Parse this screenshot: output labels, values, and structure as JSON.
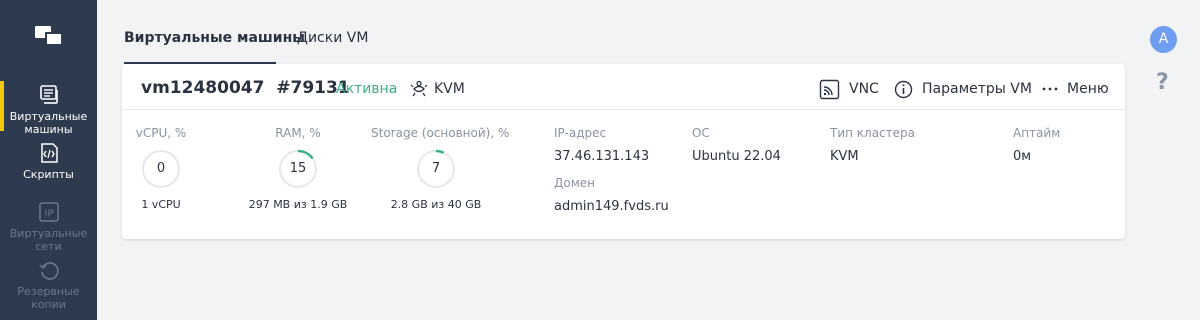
{
  "sidebar": {
    "items": [
      {
        "label": "Виртуальные машины",
        "icon": "server-icon",
        "state": "active"
      },
      {
        "label": "Скрипты",
        "icon": "script-icon",
        "state": "normal"
      },
      {
        "label": "Виртуальные сети",
        "icon": "ip-icon",
        "state": "disabled"
      },
      {
        "label": "Резервные копии",
        "icon": "backup-icon",
        "state": "disabled"
      }
    ]
  },
  "tabs": [
    {
      "label": "Виртуальные машины"
    },
    {
      "label": "Диски VM"
    }
  ],
  "vm": {
    "name": "vm12480047",
    "id": "#79131",
    "status": "Активна",
    "status_color": "#3dae89",
    "virtualization": "KVM",
    "actions": {
      "vnc": "VNC",
      "params": "Параметры VM",
      "menu": "Меню"
    },
    "metrics": {
      "cpu": {
        "label": "vCPU, %",
        "value": "0",
        "percent": 0,
        "sub": "1 vCPU"
      },
      "ram": {
        "label": "RAM, %",
        "value": "15",
        "percent": 15,
        "sub": "297 MB из 1.9 GB"
      },
      "storage": {
        "label": "Storage (основной), %",
        "value": "7",
        "percent": 7,
        "sub": "2.8 GB из 40 GB"
      }
    },
    "info": {
      "ip_label": "IP-адрес",
      "ip_value": "37.46.131.143",
      "domain_label": "Домен",
      "domain_value": "admin149.fvds.ru",
      "os_label": "ОС",
      "os_value": "Ubuntu 22.04",
      "cluster_label": "Тип кластера",
      "cluster_value": "KVM",
      "uptime_label": "Аптайм",
      "uptime_value": "0м"
    }
  },
  "user": {
    "avatar_letter": "A",
    "avatar_color": "#6f9ef0"
  },
  "help": {
    "label": "?"
  },
  "colors": {
    "accent_green": "#3dae89",
    "sidebar_bg": "#2e3b4e",
    "active_marker": "#f5c800"
  }
}
